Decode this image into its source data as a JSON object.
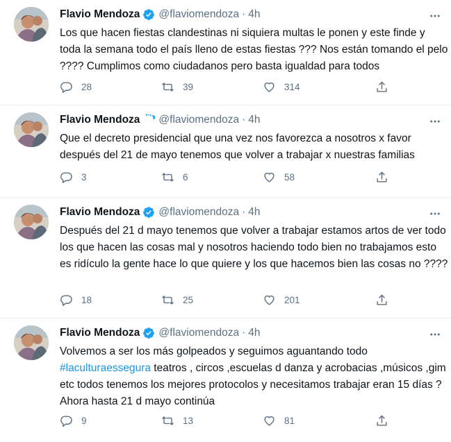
{
  "tweets": [
    {
      "name": "Flavio Mendoza",
      "handle": "@flaviomendoza",
      "time": "4h",
      "text": "Los que hacen fiestas clandestinas ni siquiera multas le ponen y este finde y toda la semana todo el país lleno de estas fiestas ??? Nos están tomando el pelo ???? Cumplimos como ciudadanos pero basta igualdad para todos",
      "replies": "28",
      "retweets": "39",
      "likes": "314"
    },
    {
      "name": "Flavio Mendoza",
      "handle": "@flaviomendoza",
      "time": "4h",
      "text": "Que el decreto presidencial que una vez nos favorezca a nosotros x favor después del 21 de mayo tenemos que volver a trabajar x nuestras familias",
      "replies": "3",
      "retweets": "6",
      "likes": "58"
    },
    {
      "name": "Flavio Mendoza",
      "handle": "@flaviomendoza",
      "time": "4h",
      "text": "Después del 21 d mayo tenemos que volver a trabajar estamos artos de ver todo los que hacen las cosas mal y nosotros haciendo todo bien no trabajamos esto es ridículo la gente hace lo que quiere y los que hacemos bien las cosas no ????",
      "replies": "18",
      "retweets": "25",
      "likes": "201"
    },
    {
      "name": "Flavio Mendoza",
      "handle": "@flaviomendoza",
      "time": "4h",
      "text_before": "Volvemos a ser los más golpeados y seguimos aguantando todo",
      "hashtag": "#laculturaessegura",
      "text_after": " teatros , circos ,escuelas d danza y acrobacias ,músicos ,gim etc todos tenemos los mejores protocolos y necesitamos trabajar eran 15 días ? Ahora hasta 21 d mayo continúa",
      "replies": "9",
      "retweets": "13",
      "likes": "81"
    }
  ],
  "separator_dot": "·",
  "colors": {
    "text": "#0f1419",
    "secondary": "#5b7083",
    "link": "#1b95e0",
    "verified": "#1da1f2",
    "divider": "#e6ecf0"
  }
}
